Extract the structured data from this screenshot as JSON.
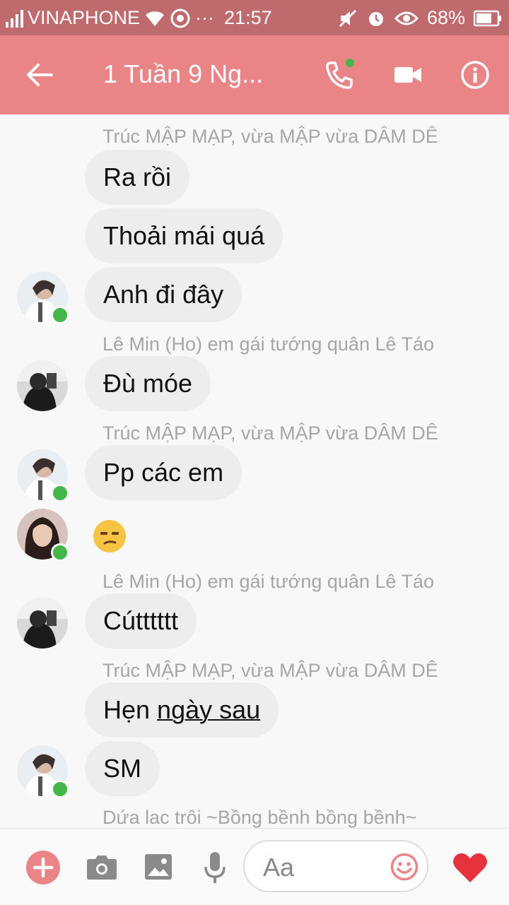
{
  "status_bar": {
    "carrier": "VINAPHONE",
    "time": "21:57",
    "more": "···",
    "battery": "68%"
  },
  "header": {
    "title": "1 Tuần 9 Ng..."
  },
  "messages": {
    "s1": "Trúc MẬP MẠP, vừa MẬP vừa DÂM DÊ",
    "m1": "Ra rồi",
    "m2": "Thoải mái quá",
    "m3": "Anh đi đây",
    "s2": "Lê Min (Ho) em gái tướng quân Lê Táo",
    "m4": "Đù móe",
    "s3": "Trúc MẬP MẠP, vừa MẬP vừa DÂM DÊ",
    "m5": "Pp các em",
    "s4": "Lê Min (Ho) em gái tướng quân Lê Táo",
    "m6": "Cútttttt",
    "s5": "Trúc MẬP MẠP, vừa MẬP vừa DÂM DÊ",
    "m7a": "Hẹn ",
    "m7b": "ngày sau",
    "m8": "SM",
    "s6": "Dứa lac trôi ~Bồng bềnh bồng bềnh~"
  },
  "composer": {
    "placeholder": "Aa"
  },
  "colors": {
    "status_bar": "#bf6a6c",
    "app_bar": "#e98487",
    "bubble": "#ededed",
    "online": "#44b548",
    "heart": "#e5323c"
  }
}
